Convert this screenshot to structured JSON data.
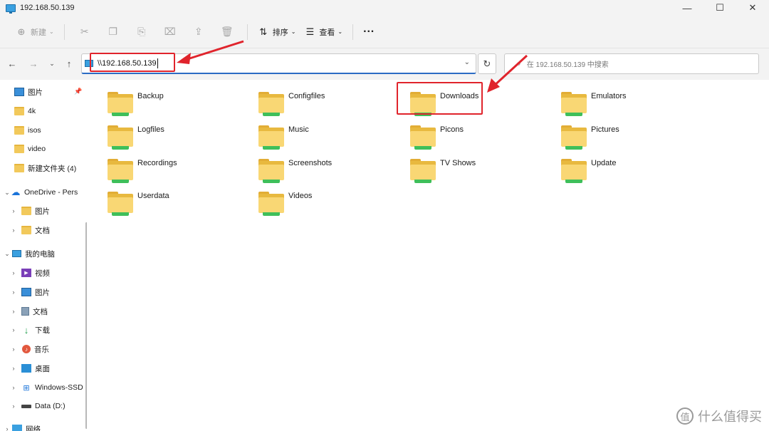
{
  "window": {
    "title": "192.168.50.139",
    "controls": [
      "—",
      "☐",
      "✕"
    ]
  },
  "toolbar": {
    "new_label": "新建",
    "sort_label": "排序",
    "view_label": "查看",
    "more": "···"
  },
  "address": {
    "path": "\\\\192.168.50.139",
    "search_placeholder": "在 192.168.50.139 中搜索"
  },
  "sidebar": {
    "items": [
      {
        "label": "图片",
        "icon": "pictures-icon"
      },
      {
        "label": "4k",
        "icon": "folder-icon"
      },
      {
        "label": "isos",
        "icon": "folder-icon"
      },
      {
        "label": "video",
        "icon": "folder-icon"
      },
      {
        "label": "新建文件夹 (4)",
        "icon": "folder-icon"
      },
      {
        "label": "OneDrive - Pers",
        "icon": "cloud-icon"
      },
      {
        "label": "图片",
        "icon": "folder-icon"
      },
      {
        "label": "文档",
        "icon": "folder-icon"
      },
      {
        "label": "我的电脑",
        "icon": "computer-icon"
      },
      {
        "label": "视频",
        "icon": "video-icon"
      },
      {
        "label": "图片",
        "icon": "pictures-icon"
      },
      {
        "label": "文档",
        "icon": "document-icon"
      },
      {
        "label": "下载",
        "icon": "download-icon"
      },
      {
        "label": "音乐",
        "icon": "music-icon"
      },
      {
        "label": "桌面",
        "icon": "desktop-icon"
      },
      {
        "label": "Windows-SSD",
        "icon": "drive-icon"
      },
      {
        "label": "Data (D:)",
        "icon": "drive-icon"
      },
      {
        "label": "网络",
        "icon": "network-icon"
      }
    ]
  },
  "folders": [
    "Backup",
    "Configfiles",
    "Downloads",
    "Emulators",
    "Logfiles",
    "Music",
    "Picons",
    "Pictures",
    "Recordings",
    "Screenshots",
    "TV Shows",
    "Update",
    "Userdata",
    "Videos"
  ],
  "watermark": {
    "logo_char": "值",
    "text": "什么值得买"
  },
  "colors": {
    "accent": "#2b6cc4",
    "annotation": "#e0242c",
    "folder": "#f9d774"
  }
}
